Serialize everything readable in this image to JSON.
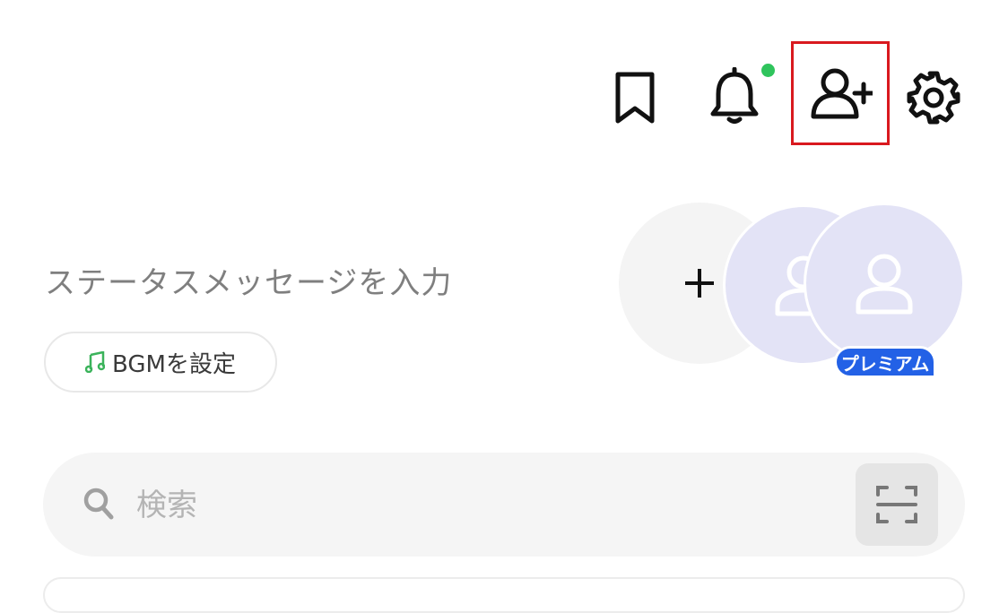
{
  "header": {
    "icons": [
      {
        "name": "bookmark-icon"
      },
      {
        "name": "bell-icon",
        "has_notification": true
      },
      {
        "name": "add-friend-icon",
        "highlighted": true
      },
      {
        "name": "gear-icon"
      }
    ]
  },
  "profile": {
    "status_message_placeholder": "ステータスメッセージを入力",
    "bgm_button_label": "BGMを設定",
    "premium_badge": "プレミアム"
  },
  "search": {
    "placeholder": "検索",
    "value": ""
  },
  "colors": {
    "notification_dot": "#2fc45c",
    "highlight_border": "#d9191f",
    "premium_badge": "#2361e6",
    "avatar_bg": "#e3e3f6",
    "bgm_icon": "#3bb35b"
  }
}
